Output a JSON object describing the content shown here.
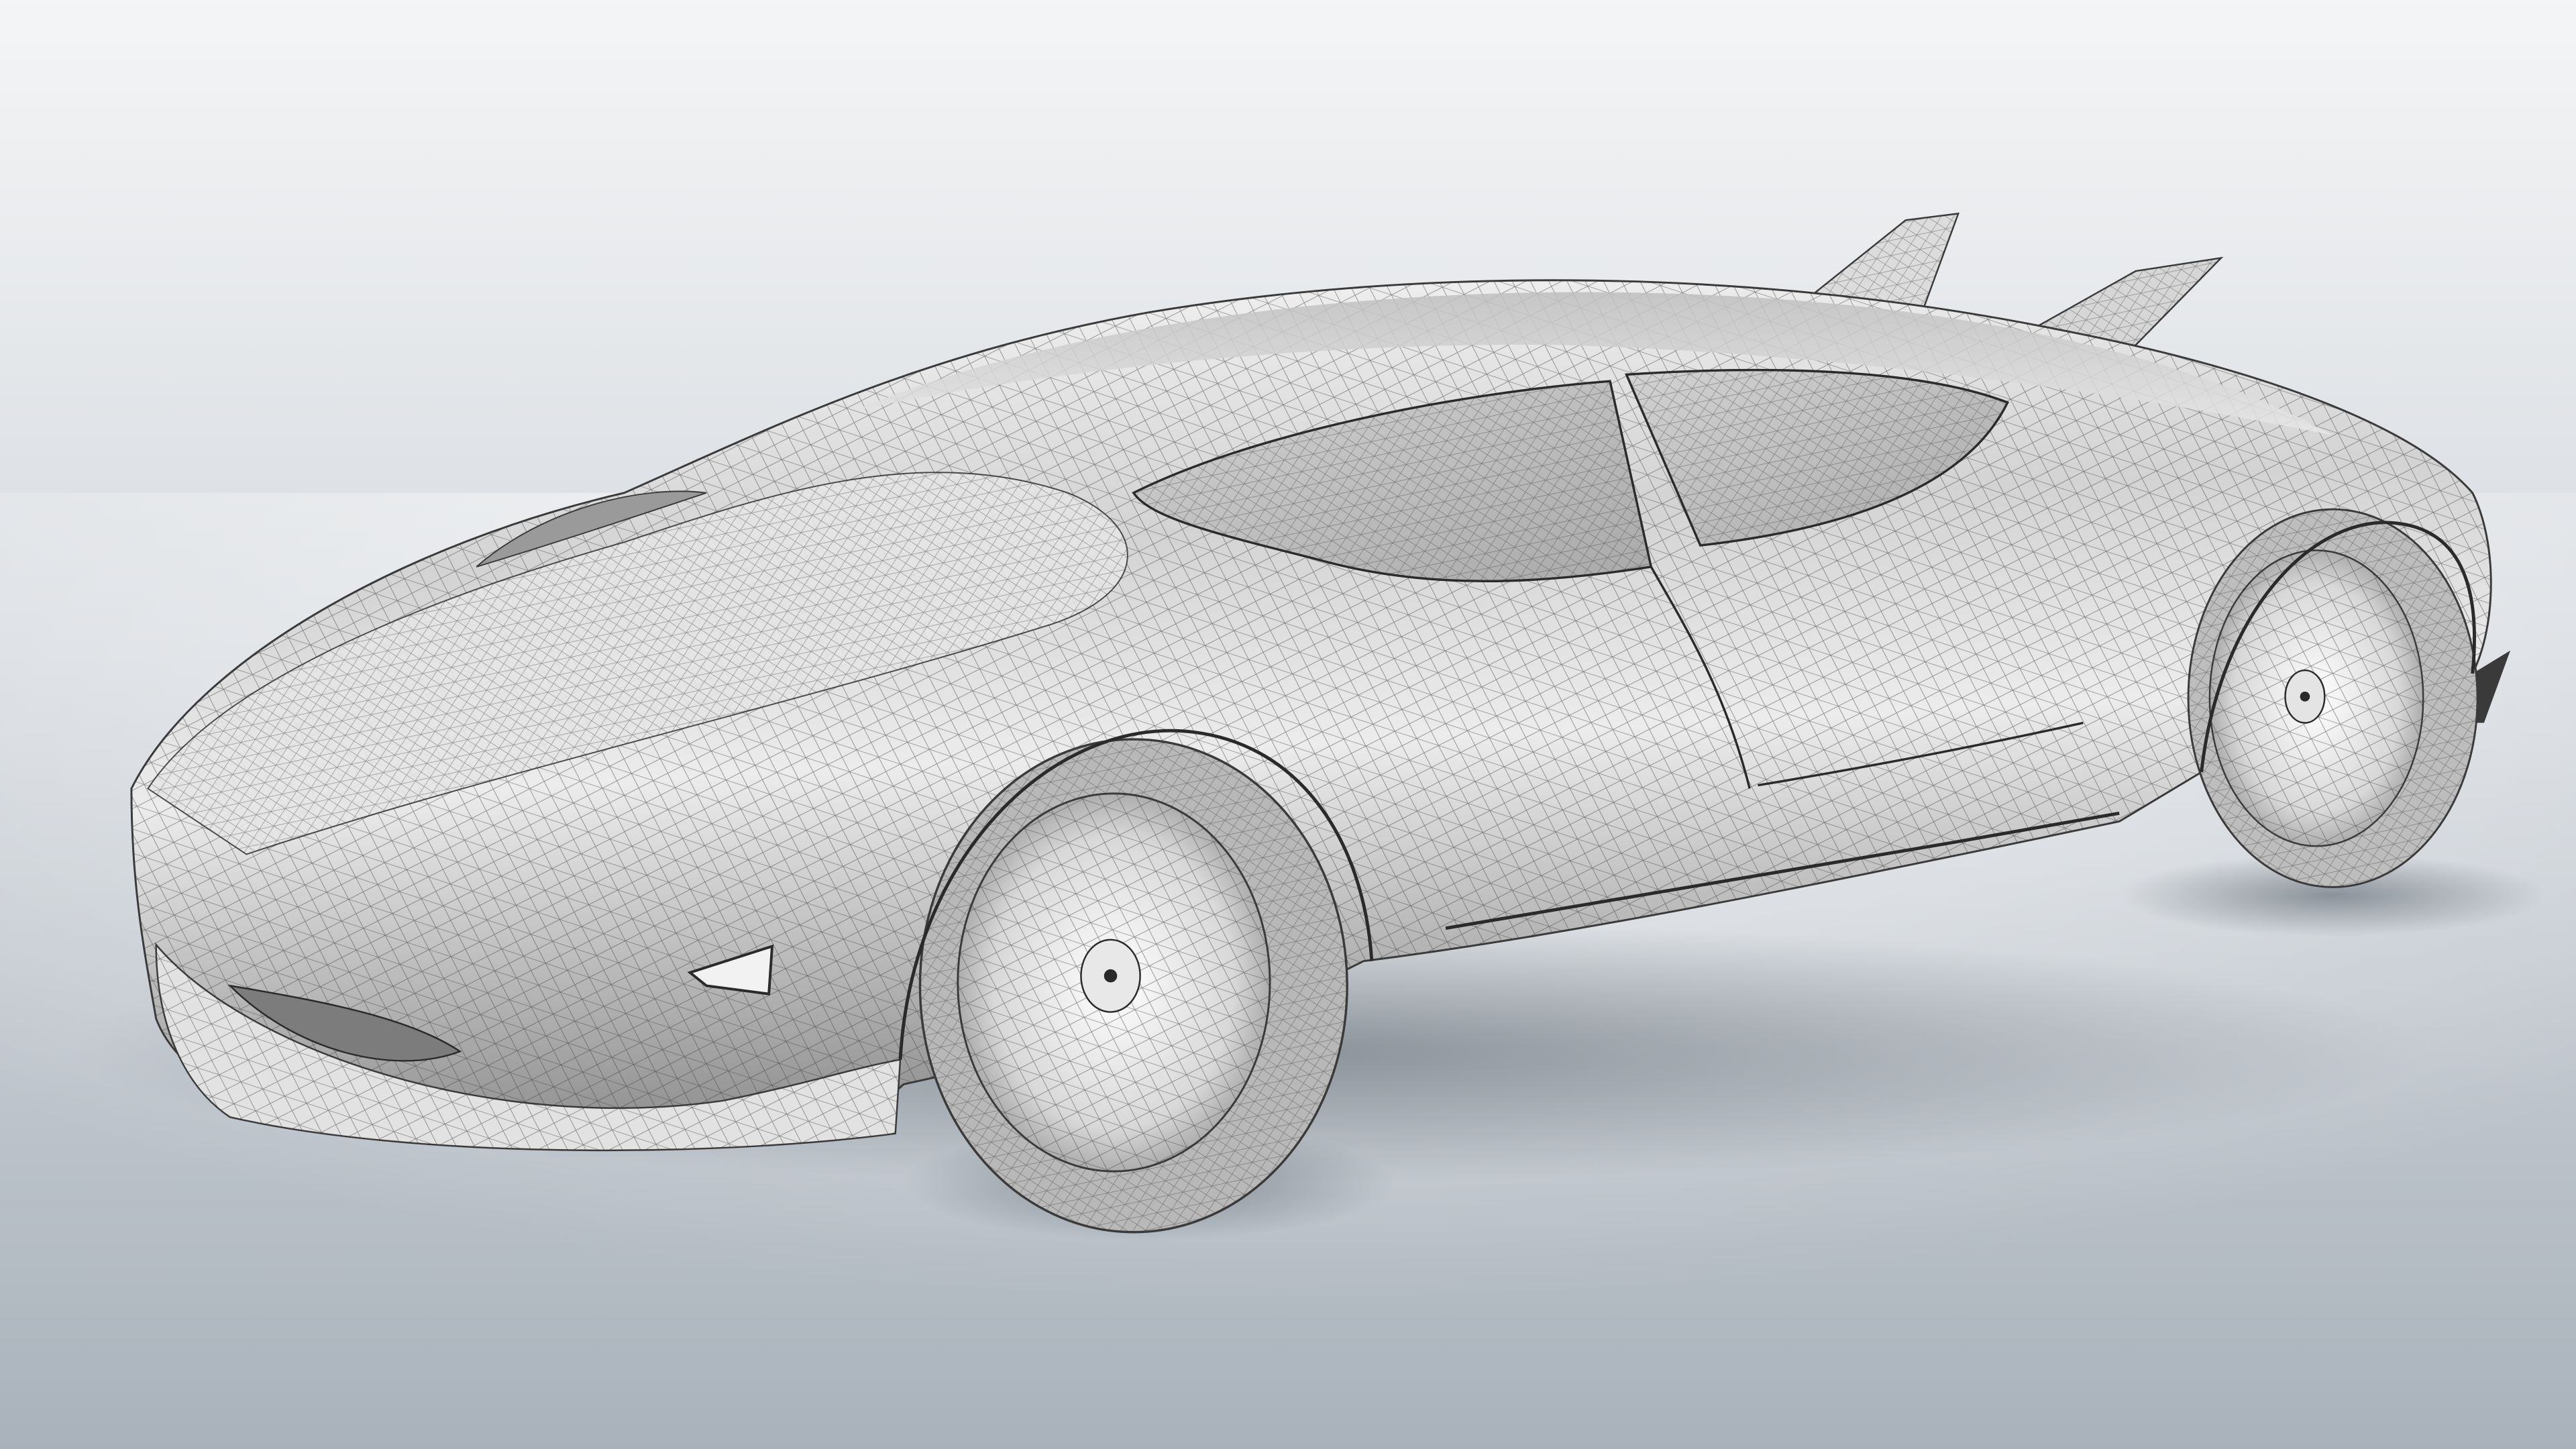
{
  "scene": {
    "subject": "concept-car-wireframe-render",
    "colors": {
      "background_top": "#f4f5f6",
      "background_mid": "#d7dbe0",
      "background_bottom": "#a9b2bb",
      "body_light": "#ffffff",
      "body_mid": "#c9c9c9",
      "body_dark": "#6c6c6c",
      "wire": "#3a3a3a",
      "tire": "#8c8c8c",
      "shadow": "#5c6670"
    }
  }
}
